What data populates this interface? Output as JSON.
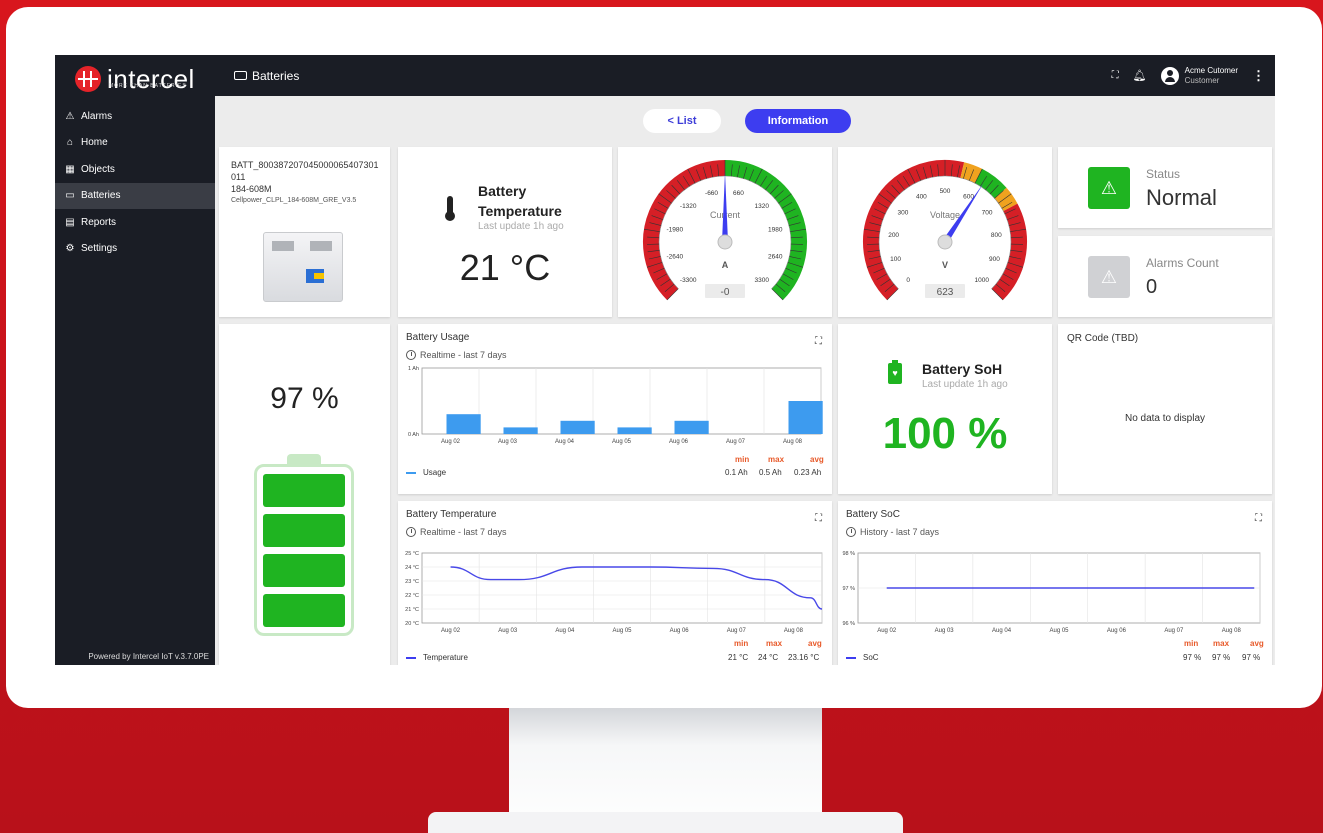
{
  "app": {
    "logo_text": "intercel",
    "logo_sub": "MORE THAN BATTERIES",
    "page_title": "Batteries",
    "powered_by": "Powered by Intercel IoT v.3.7.0PE"
  },
  "sidebar": {
    "items": [
      {
        "label": "Alarms",
        "icon": "warning-icon"
      },
      {
        "label": "Home",
        "icon": "home-icon"
      },
      {
        "label": "Objects",
        "icon": "objects-icon"
      },
      {
        "label": "Batteries",
        "icon": "battery-icon"
      },
      {
        "label": "Reports",
        "icon": "reports-icon"
      },
      {
        "label": "Settings",
        "icon": "gear-icon"
      }
    ],
    "active": "Batteries"
  },
  "user": {
    "name": "Acme Cutomer",
    "role": "Customer"
  },
  "tabs": {
    "list_label": "< List",
    "info_label": "Information"
  },
  "device": {
    "id_line1": "BATT_8003872070450000654073​01",
    "id_line2": "011",
    "model": "184-608M",
    "config": "Cellpower_CLPL_184-608M_GRE_V3.5"
  },
  "temperature": {
    "title_line1": "Battery",
    "title_line2": "Temperature",
    "updated": "Last update 1h ago",
    "value": "21 °C"
  },
  "current_gauge": {
    "label": "Current",
    "unit": "A",
    "value": "-0",
    "ticks": [
      "-3300",
      "-2640",
      "-1980",
      "-1320",
      "-660",
      "660",
      "1320",
      "1980",
      "2640",
      "3300"
    ],
    "needle_fraction": 0.5
  },
  "voltage_gauge": {
    "label": "Voltage",
    "unit": "V",
    "value": "623",
    "ticks": [
      "0",
      "100",
      "200",
      "300",
      "400",
      "500",
      "600",
      "700",
      "800",
      "900",
      "1000"
    ],
    "needle_fraction": 0.623
  },
  "status": {
    "label": "Status",
    "value": "Normal"
  },
  "alarms": {
    "label": "Alarms Count",
    "value": "0"
  },
  "soc_big": {
    "value": "97 %",
    "fraction": 0.97
  },
  "soh": {
    "title": "Battery SoH",
    "updated": "Last update 1h ago",
    "value": "100 %"
  },
  "qr": {
    "title": "QR Code (TBD)",
    "empty": "No data to display"
  },
  "usage_chart": {
    "title": "Battery Usage",
    "subtitle": "Realtime - last 7 days",
    "stats_headers": [
      "min",
      "max",
      "avg"
    ],
    "legend": "Usage",
    "stats": [
      "0.1 Ah",
      "0.5 Ah",
      "0.23 Ah"
    ]
  },
  "temp_chart": {
    "title": "Battery Temperature",
    "subtitle": "Realtime - last 7 days",
    "stats_headers": [
      "min",
      "max",
      "avg"
    ],
    "legend": "Temperature",
    "stats": [
      "21 °C",
      "24 °C",
      "23.16 °C"
    ]
  },
  "soc_chart": {
    "title": "Battery SoC",
    "subtitle": "History - last 7 days",
    "stats_headers": [
      "min",
      "max",
      "avg"
    ],
    "legend": "SoC",
    "stats": [
      "97 %",
      "97 %",
      "97 %"
    ]
  },
  "chart_data": [
    {
      "type": "bar",
      "title": "Battery Usage",
      "categories": [
        "Aug 02",
        "Aug 03",
        "Aug 04",
        "Aug 05",
        "Aug 06",
        "Aug 07",
        "Aug 08"
      ],
      "y_ticks": [
        "0 Ah",
        "1 Ah"
      ],
      "ylim": [
        0,
        1
      ],
      "series": [
        {
          "name": "Usage",
          "values": [
            0.3,
            0.1,
            0.2,
            0.1,
            0.2,
            0,
            0.5
          ]
        }
      ],
      "color": "#3d9bef"
    },
    {
      "type": "line",
      "title": "Battery Temperature",
      "categories": [
        "Aug 02",
        "Aug 03",
        "Aug 04",
        "Aug 05",
        "Aug 06",
        "Aug 07",
        "Aug 08"
      ],
      "y_ticks": [
        "20 °C",
        "21 °C",
        "22 °C",
        "23 °C",
        "24 °C",
        "25 °C"
      ],
      "ylim": [
        20,
        25
      ],
      "series": [
        {
          "name": "Temperature",
          "x": [
            0,
            0.7,
            1.2,
            2.3,
            3.5,
            4.6,
            5.5,
            6.3,
            6.5
          ],
          "values": [
            24,
            23.1,
            23.1,
            24,
            24,
            23.9,
            23.1,
            21.8,
            21
          ]
        }
      ],
      "color": "#4848e8"
    },
    {
      "type": "line",
      "title": "Battery SoC",
      "categories": [
        "Aug 02",
        "Aug 03",
        "Aug 04",
        "Aug 05",
        "Aug 06",
        "Aug 07",
        "Aug 08"
      ],
      "y_ticks": [
        "96 %",
        "97 %",
        "98 %"
      ],
      "ylim": [
        96,
        98
      ],
      "series": [
        {
          "name": "SoC",
          "x": [
            0,
            6.4
          ],
          "values": [
            97,
            97
          ]
        }
      ],
      "color": "#4848e8"
    }
  ],
  "colors": {
    "accent": "#3d3df0",
    "green": "#1fb421",
    "red": "#e52329",
    "dark": "#1a1d25"
  }
}
